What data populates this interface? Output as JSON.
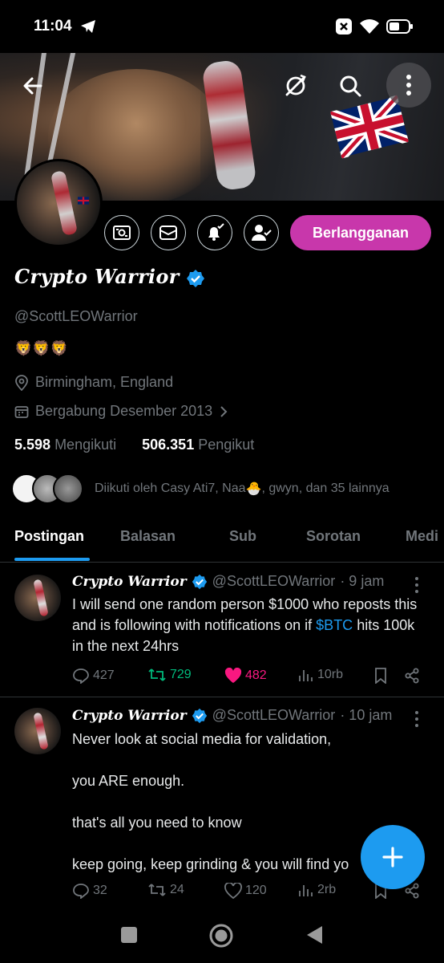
{
  "status_bar": {
    "time": "11:04"
  },
  "header": {},
  "profile": {
    "display_name": "Crypto Warrior",
    "handle": "@ScottLEOWarrior",
    "bio": "🦁🦁🦁",
    "location": "Birmingham, England",
    "joined": "Bergabung Desember 2013",
    "following_count": "5.598",
    "following_label": "Mengikuti",
    "followers_count": "506.351",
    "followers_label": "Pengikut",
    "subscribe_label": "Berlangganan",
    "followed_by_prefix": "Diikuti oleh Casy Ati7, Naa ",
    "followed_by_emoji": "🐣",
    "followed_by_suffix": ", gwyn, dan 35 lainnya"
  },
  "tabs": [
    {
      "label": "Postingan",
      "active": true
    },
    {
      "label": "Balasan"
    },
    {
      "label": "Sub"
    },
    {
      "label": "Sorotan"
    },
    {
      "label": "Medi"
    }
  ],
  "tweets": [
    {
      "name": "Crypto Warrior",
      "handle": "@ScottLEOWarrior",
      "time": "· 9 jam",
      "text_before": "I will send one random person $1000 who reposts this and is following with notifications on if ",
      "cashtag": "$BTC",
      "text_after": " hits 100k in the next 24hrs",
      "replies": "427",
      "reposts": "729",
      "likes": "482",
      "views": "10rb"
    },
    {
      "name": "Crypto Warrior",
      "handle": "@ScottLEOWarrior",
      "time": "· 10 jam",
      "line1": "Never look at social media for validation,",
      "line2": "you ARE enough.",
      "line3": "that's all you need to know",
      "line4": "keep going, keep grinding & you will find yo",
      "replies": "32",
      "reposts": "24",
      "likes": "120",
      "views": "2rb"
    }
  ],
  "colors": {
    "accent": "#1d9bf0",
    "subscribe": "#c837ab",
    "like": "#f91880",
    "repost": "#00ba7c",
    "muted": "#71767b"
  },
  "icons": [
    "back-arrow-icon",
    "sync-off-icon",
    "search-icon",
    "more-vertical-icon",
    "payment-icon",
    "mail-icon",
    "bell-check-icon",
    "user-check-icon",
    "location-icon",
    "calendar-icon",
    "chevron-right-icon",
    "reply-icon",
    "repost-icon",
    "heart-icon",
    "views-icon",
    "bookmark-icon",
    "share-icon",
    "plus-icon"
  ]
}
